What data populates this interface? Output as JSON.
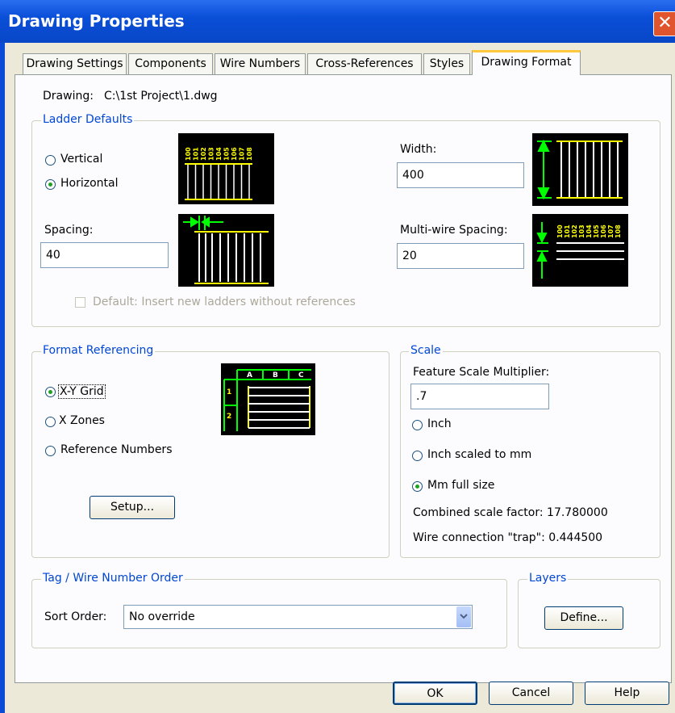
{
  "window": {
    "title": "Drawing Properties",
    "close_glyph": "✕"
  },
  "tabs": [
    {
      "label": "Drawing Settings"
    },
    {
      "label": "Components"
    },
    {
      "label": "Wire Numbers"
    },
    {
      "label": "Cross-References"
    },
    {
      "label": "Styles"
    },
    {
      "label": "Drawing Format",
      "active": true
    }
  ],
  "drawing": {
    "label": "Drawing:",
    "path": "C:\\1st Project\\1.dwg"
  },
  "ladder_defaults": {
    "title": "Ladder Defaults",
    "vertical_label": "Vertical",
    "horizontal_label": "Horizontal",
    "selected": "Horizontal",
    "spacing_label": "Spacing:",
    "spacing_value": "40",
    "width_label": "Width:",
    "width_value": "400",
    "multiwire_label": "Multi-wire Spacing:",
    "multiwire_value": "20",
    "default_checkbox_label": "Default: Insert new ladders without references",
    "default_checked": false,
    "preview_numbers": [
      "100",
      "101",
      "102",
      "103",
      "104",
      "105",
      "106",
      "107",
      "108"
    ]
  },
  "format_referencing": {
    "title": "Format Referencing",
    "options": [
      "X-Y Grid",
      "X Zones",
      "Reference Numbers"
    ],
    "selected": "X-Y Grid",
    "setup_label": "Setup...",
    "grid_cols": [
      "A",
      "B",
      "C"
    ],
    "grid_rows": [
      "1",
      "2"
    ]
  },
  "scale": {
    "title": "Scale",
    "feature_label": "Feature Scale Multiplier:",
    "feature_value": ".7",
    "options": [
      "Inch",
      "Inch scaled to mm",
      "Mm full size"
    ],
    "selected": "Mm full size",
    "combined": "Combined scale factor: 17.780000",
    "trap": "Wire connection \"trap\": 0.444500"
  },
  "tag_order": {
    "title": "Tag / Wire Number Order",
    "sort_label": "Sort Order:",
    "sort_value": "No override"
  },
  "layers": {
    "title": "Layers",
    "define_label": "Define..."
  },
  "footer": {
    "ok": "OK",
    "cancel": "Cancel",
    "help": "Help"
  },
  "colors": {
    "title_bar": "#0a4fd8",
    "group_title": "#0046d5",
    "preview_wire": "#ffff00",
    "preview_arrow": "#00ff00",
    "active_tab_accent": "#ffc83c"
  }
}
